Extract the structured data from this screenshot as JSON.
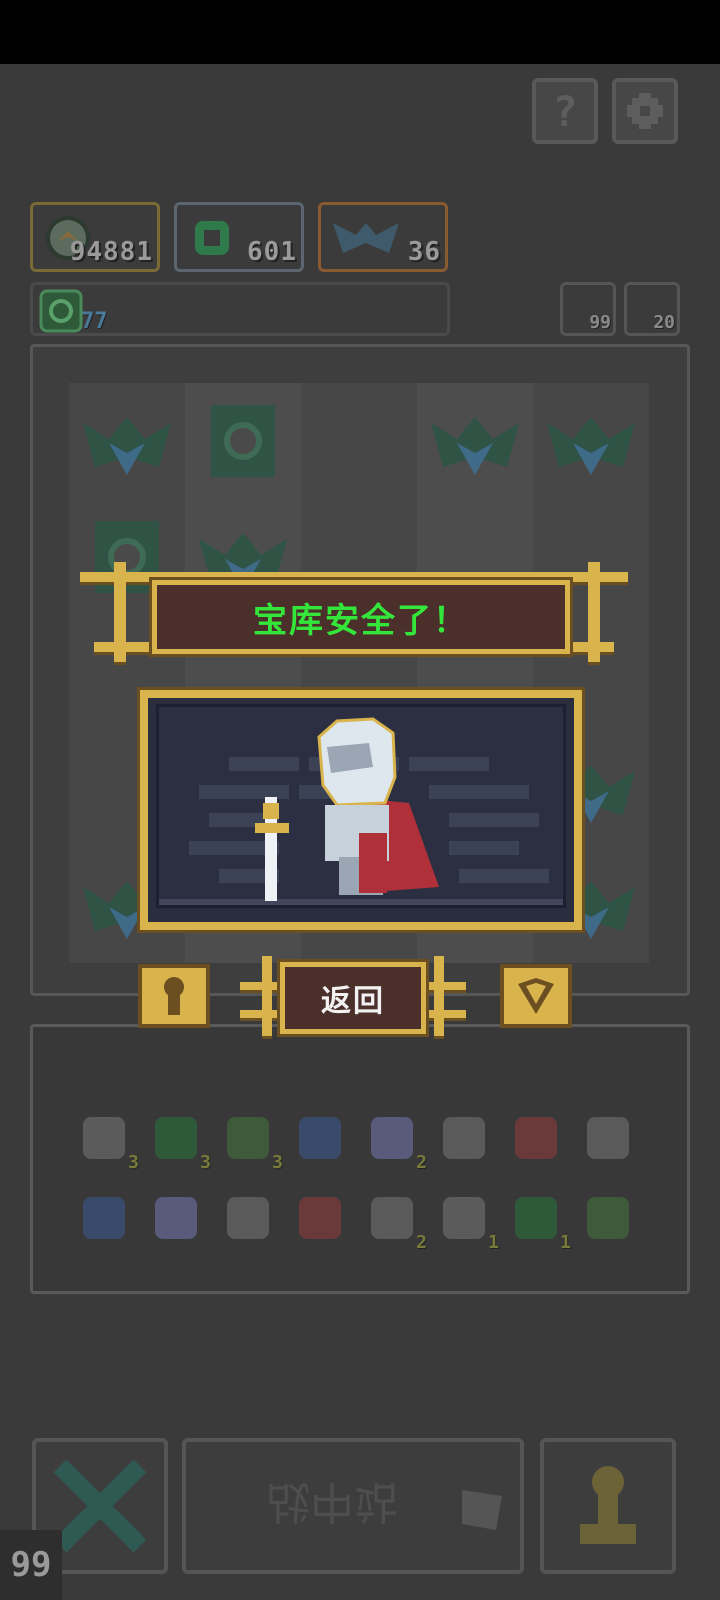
{
  "resources": {
    "gold": "94881",
    "gems": "601",
    "bats": "36",
    "keys": "77"
  },
  "side_counters": {
    "first": "99",
    "second": "20"
  },
  "inventory": {
    "row1_badges": [
      "3",
      "3",
      "3",
      "",
      "2",
      "",
      "",
      ""
    ],
    "row2_badges": [
      "",
      "",
      "",
      "",
      "2",
      "1",
      "1",
      ""
    ]
  },
  "dialog": {
    "title": "宝库安全了！",
    "return_label": "返回"
  },
  "bottom": {
    "battle_label": "战中站",
    "lives": "99"
  },
  "colors": {
    "gold_frame": "#d9b44c",
    "banner_bg": "#4a2f2b",
    "title_text": "#35e63a",
    "board_bg": "#3e3e3e"
  },
  "icons": {
    "help": "question-icon",
    "settings": "gear-icon",
    "close": "x-icon",
    "hero": "pawn-icon",
    "lock": "keyhole-icon",
    "shield": "shield-icon"
  }
}
